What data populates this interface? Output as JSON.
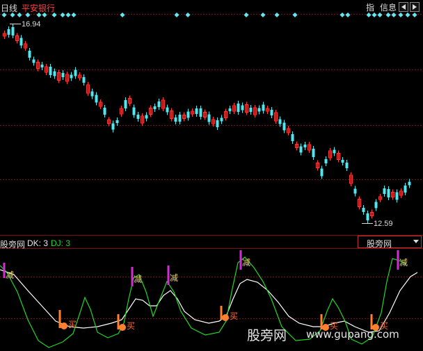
{
  "header": {
    "period": "日线",
    "stock_name": "平安银行",
    "btn_zhi": "指",
    "btn_info": "信息"
  },
  "price_chart": {
    "high_label": "16.94",
    "low_label": "12.59"
  },
  "indicator": {
    "name": "股旁网",
    "dk_label": "DK: 3",
    "dj_label": "DJ: 3",
    "selector_value": "股旁网",
    "sell_label": "减",
    "buy_label": "买"
  },
  "watermark": {
    "text": "股旁网",
    "url": "www.gupang.com"
  },
  "colors": {
    "up": "#ff3b3b",
    "down": "#4ee8f0",
    "grid": "#7a1010",
    "dk": "#ffffff",
    "dj": "#22d822",
    "sell_bar": "#d030d0",
    "buy_bar": "#ff8030",
    "diamond": "#60e8f0"
  }
}
